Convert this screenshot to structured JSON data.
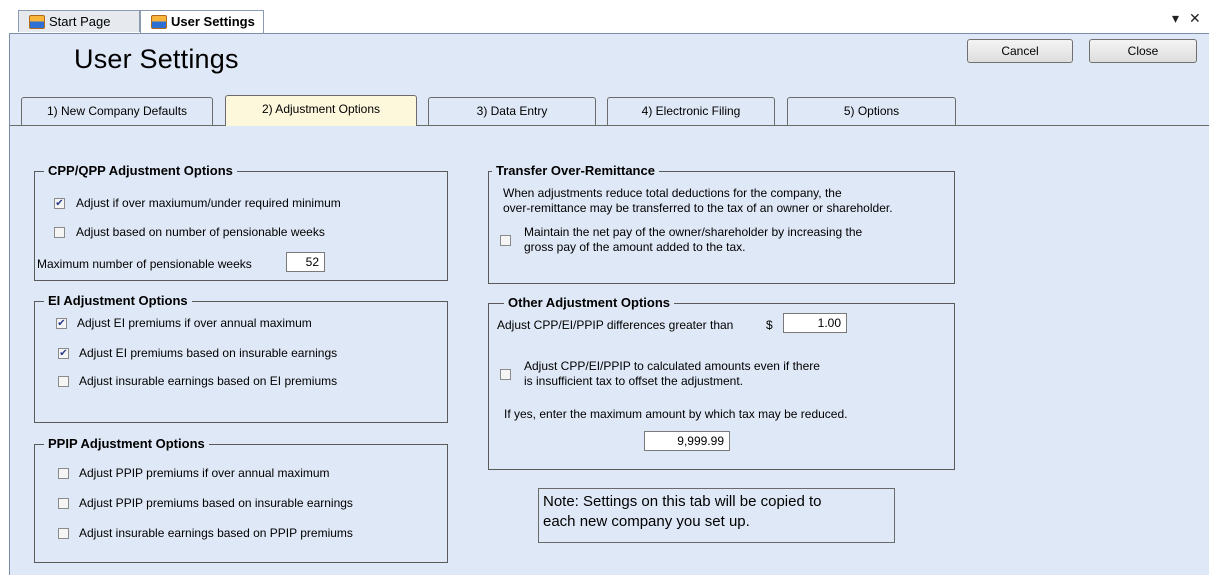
{
  "doc_tabs": [
    {
      "label": "Start Page",
      "icon": "app-icon"
    },
    {
      "label": "User Settings",
      "icon": "app-icon",
      "active": true
    }
  ],
  "strip_controls": {
    "dropdown": "▾",
    "close": "✕"
  },
  "page_title": "User Settings",
  "buttons": {
    "cancel": "Cancel",
    "close": "Close"
  },
  "settings_tabs": [
    "1) New Company Defaults",
    "2) Adjustment Options",
    "3) Data Entry",
    "4) Electronic Filing",
    "5) Options"
  ],
  "active_settings_tab": "2) Adjustment Options",
  "cpp": {
    "title": "CPP/QPP Adjustment Options",
    "opt1": {
      "label": "Adjust if over maxiumum/under required minimum",
      "checked": true
    },
    "opt2": {
      "label": "Adjust based on number of pensionable weeks",
      "checked": false
    },
    "max_weeks_label": "Maximum number of pensionable weeks",
    "max_weeks_value": "52"
  },
  "ei": {
    "title": "EI Adjustment Options",
    "opt1": {
      "label": "Adjust EI premiums if over annual maximum",
      "checked": true
    },
    "opt2": {
      "label": "Adjust EI premiums based on insurable earnings",
      "checked": true
    },
    "opt3": {
      "label": "Adjust insurable earnings based on EI premiums",
      "checked": false
    }
  },
  "ppip": {
    "title": "PPIP Adjustment Options",
    "opt1": {
      "label": "Adjust PPIP premiums if over annual maximum",
      "checked": false
    },
    "opt2": {
      "label": "Adjust PPIP premiums based on insurable earnings",
      "checked": false
    },
    "opt3": {
      "label": "Adjust insurable earnings based on PPIP premiums",
      "checked": false
    }
  },
  "transfer": {
    "title": "Transfer Over-Remittance",
    "desc_line1": "When adjustments reduce total deductions for the company, the",
    "desc_line2": "over-remittance may be transferred to the tax of an owner or shareholder.",
    "opt_line1": "Maintain the net pay of the owner/shareholder by increasing the",
    "opt_line2": "gross pay of the amount added to the tax.",
    "checked": false
  },
  "other": {
    "title": "Other Adjustment Options",
    "diff_label": "Adjust CPP/EI/PPIP differences greater than",
    "currency": "$",
    "diff_value": "1.00",
    "opt_line1": "Adjust CPP/EI/PPIP to calculated amounts even if there",
    "opt_line2": "is insufficient tax to offset the adjustment.",
    "opt_checked": false,
    "max_label": "If yes, enter the maximum amount by which tax may be reduced.",
    "max_value": "9,999.99"
  },
  "note": {
    "line1": "Note:  Settings on this tab will be copied to",
    "line2": "each new company you set up."
  },
  "colors": {
    "panel_bg": "#dfe8f6",
    "active_tab_bg": "#fdf8dc"
  }
}
